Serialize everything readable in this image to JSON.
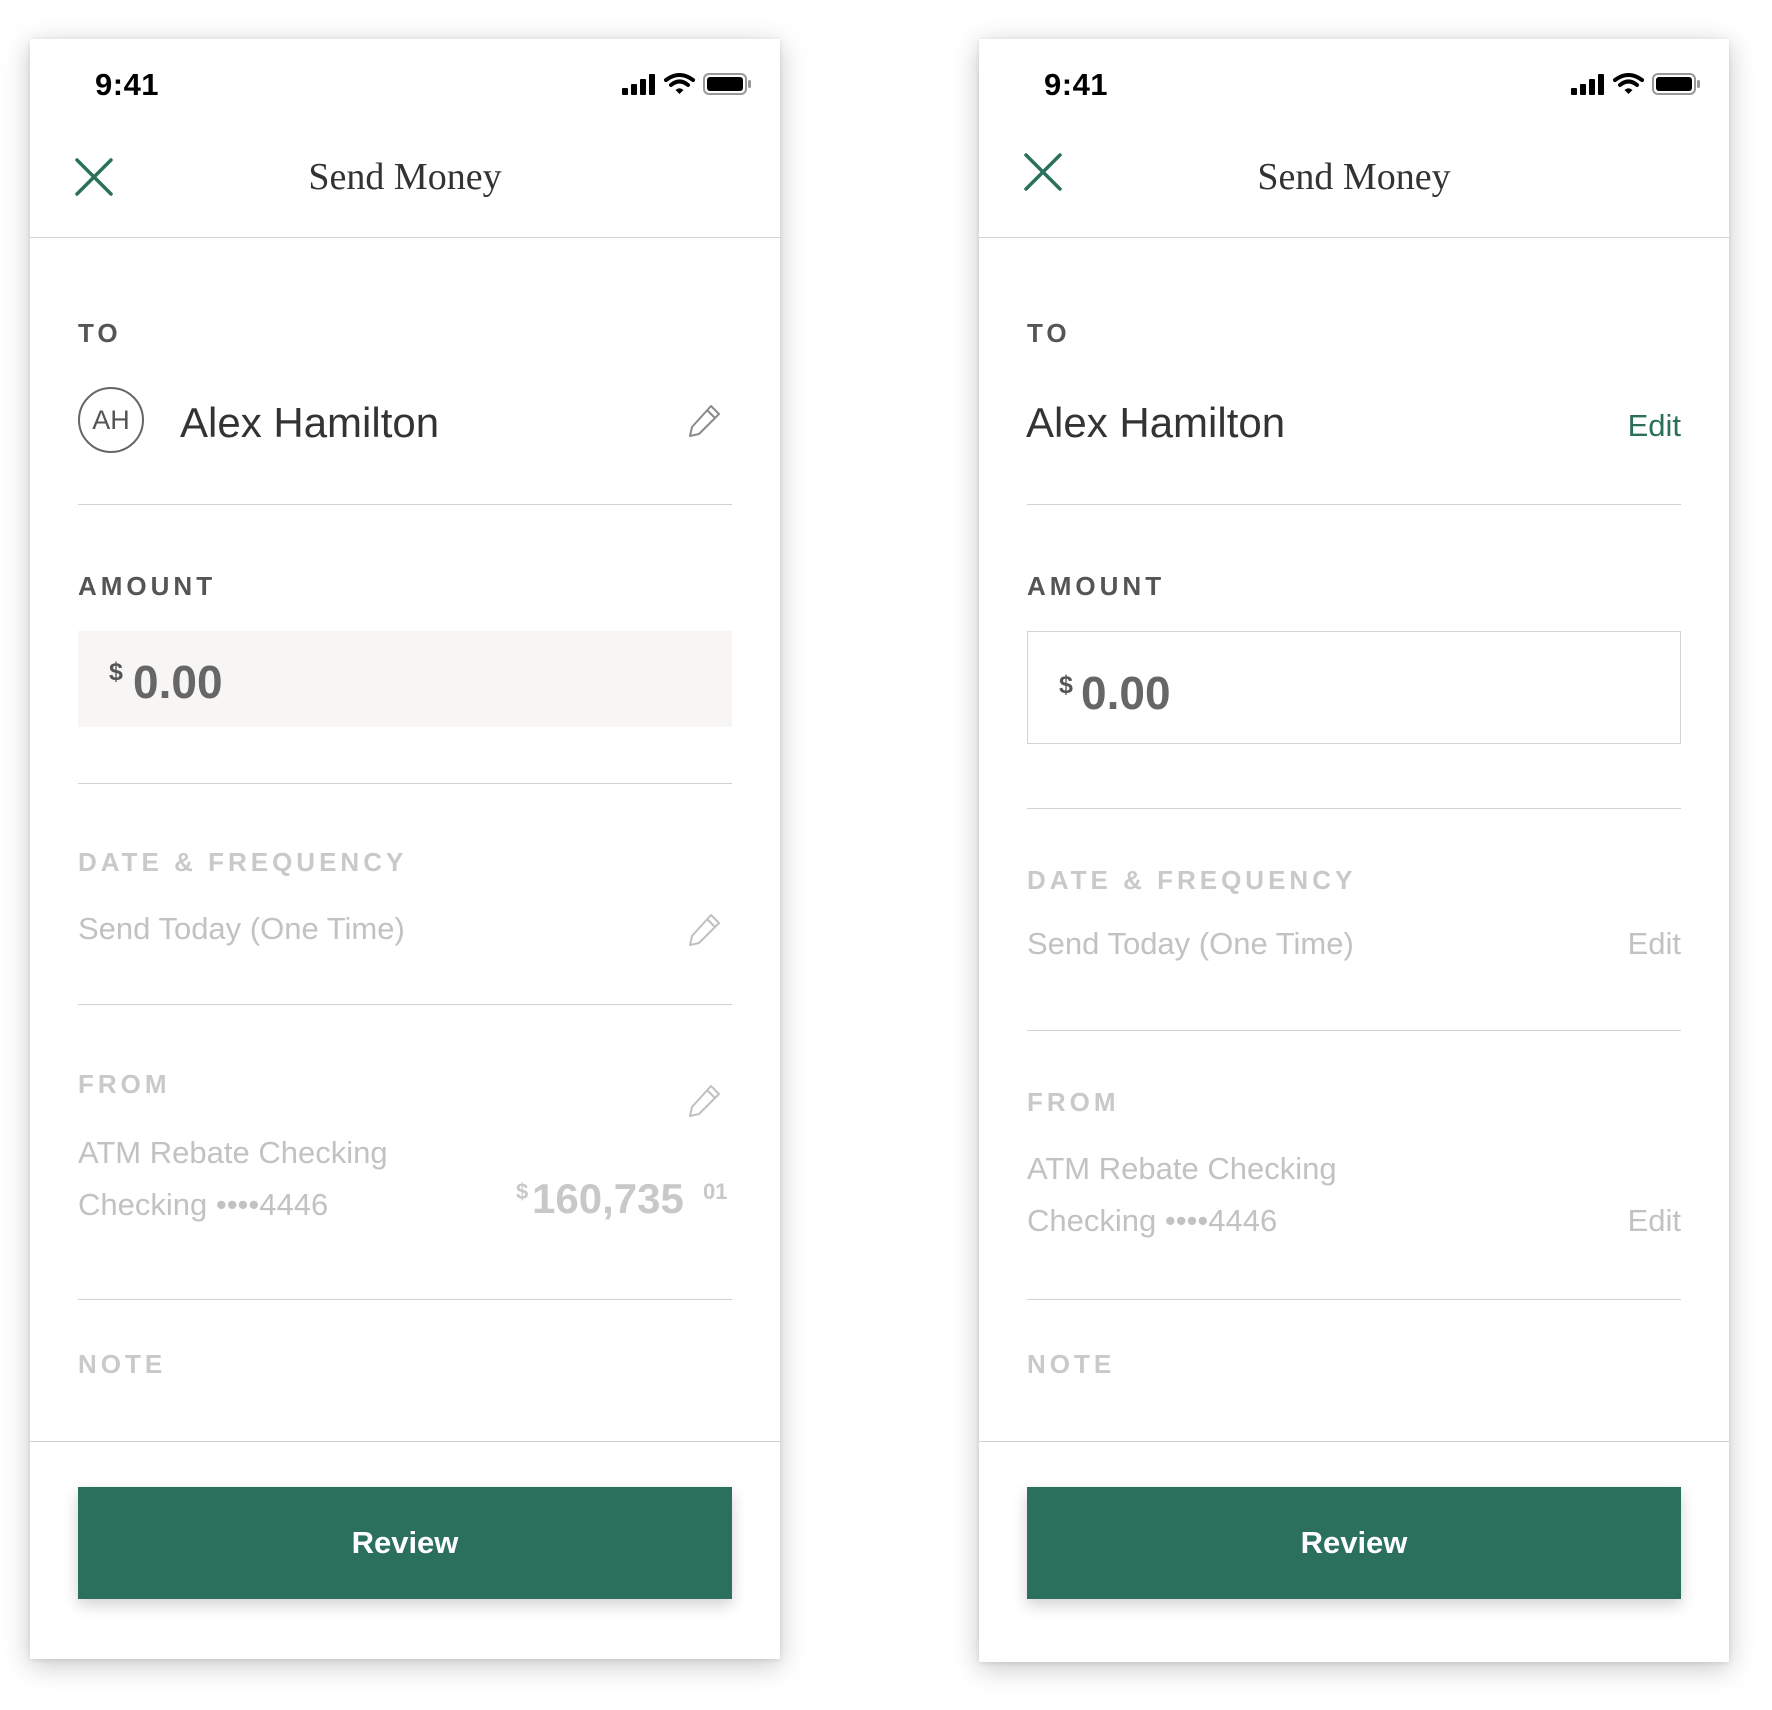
{
  "colors": {
    "accent": "#2b705c",
    "muted": "#c2c2c2"
  },
  "screens": [
    {
      "variant": "pencil-icons",
      "status": {
        "time": "9:41"
      },
      "header": {
        "title": "Send Money",
        "close_icon": "close-x-icon"
      },
      "to": {
        "label": "TO",
        "avatar_initials": "AH",
        "name": "Alex Hamilton",
        "edit_icon": "pencil-icon"
      },
      "amount": {
        "label": "AMOUNT",
        "currency": "$",
        "value": "0.00"
      },
      "date": {
        "label": "DATE & FREQUENCY",
        "value": "Send Today (One Time)",
        "edit_icon": "pencil-icon"
      },
      "from": {
        "label": "FROM",
        "account_name": "ATM Rebate Checking",
        "account_number": "Checking ••••4446",
        "balance_currency": "$",
        "balance_whole": "160,735",
        "balance_cents": "01",
        "edit_icon": "pencil-icon"
      },
      "note": {
        "label": "NOTE"
      },
      "review_label": "Review"
    },
    {
      "variant": "edit-links",
      "status": {
        "time": "9:41"
      },
      "header": {
        "title": "Send Money",
        "close_icon": "close-x-icon"
      },
      "to": {
        "label": "TO",
        "name": "Alex Hamilton",
        "edit_label": "Edit"
      },
      "amount": {
        "label": "AMOUNT",
        "currency": "$",
        "value": "0.00"
      },
      "date": {
        "label": "DATE & FREQUENCY",
        "value": "Send Today (One Time)",
        "edit_label": "Edit"
      },
      "from": {
        "label": "FROM",
        "account_name": "ATM Rebate Checking",
        "account_number": "Checking ••••4446",
        "edit_label": "Edit"
      },
      "note": {
        "label": "NOTE"
      },
      "review_label": "Review"
    }
  ]
}
